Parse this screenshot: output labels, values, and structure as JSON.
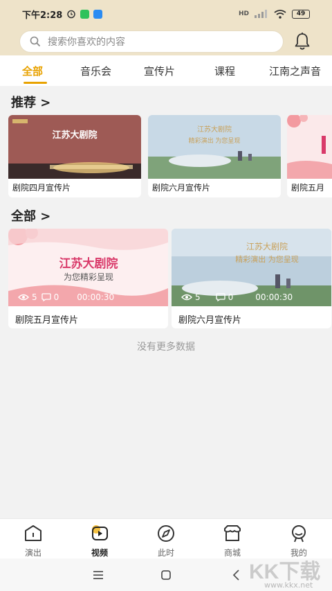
{
  "status_bar": {
    "time": "下午2:28",
    "network": "HD",
    "battery": "49"
  },
  "search": {
    "placeholder": "搜索你喜欢的内容"
  },
  "tabs": [
    "全部",
    "音乐会",
    "宣传片",
    "课程",
    "江南之声音"
  ],
  "sections": {
    "recommend_title": "推荐 >",
    "all_title": "全部 >"
  },
  "recommend": [
    {
      "caption": "剧院四月宣传片",
      "thumb_text": "江苏大剧院"
    },
    {
      "caption": "剧院六月宣传片",
      "thumb_line1": "江苏大剧院",
      "thumb_line2": "精彩演出 为您呈现"
    },
    {
      "caption": "剧院五月"
    }
  ],
  "all": [
    {
      "caption": "剧院五月宣传片",
      "thumb_line1": "江苏大剧院",
      "thumb_line2": "为您精彩呈现",
      "views": "5",
      "comments": "0",
      "duration": "00:00:30"
    },
    {
      "caption": "剧院六月宣传片",
      "thumb_line1": "江苏大剧院",
      "thumb_line2": "精彩演出 为您呈现",
      "views": "5",
      "comments": "0",
      "duration": "00:00:30"
    }
  ],
  "no_more": "没有更多数据",
  "bottom_nav": [
    "演出",
    "视频",
    "此时",
    "商城",
    "我的"
  ],
  "watermark": {
    "main": "KK下载",
    "sub": "www.kkx.net"
  },
  "colors": {
    "accent": "#e8a200",
    "header_bg": "#eee3c9"
  }
}
